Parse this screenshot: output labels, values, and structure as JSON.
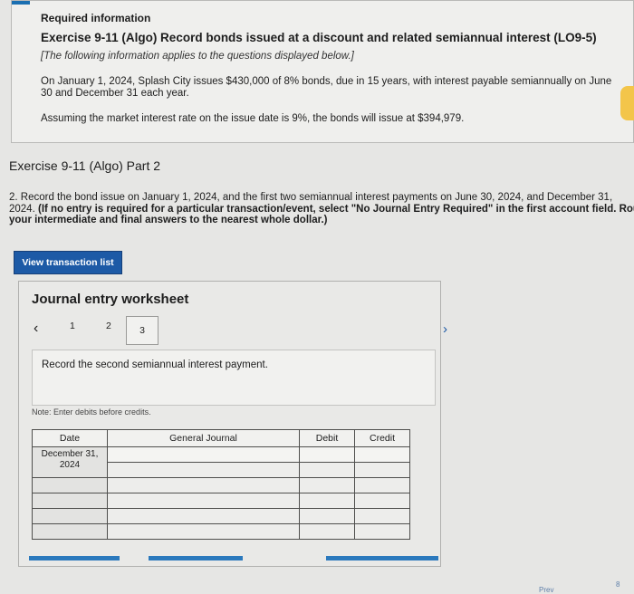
{
  "info": {
    "required": "Required information",
    "exercise_title": "Exercise 9-11 (Algo) Record bonds issued at a discount and related semiannual interest (LO9-5)",
    "note": "[The following information applies to the questions displayed below.]",
    "paragraph1": "On January 1, 2024, Splash City issues $430,000 of 8% bonds, due in 15 years, with interest payable semiannually on June 30 and December 31 each year.",
    "paragraph2": "Assuming the market interest rate on the issue date is 9%, the bonds will issue at $394,979."
  },
  "part_title": "Exercise 9-11 (Algo) Part 2",
  "question": {
    "line1": "2. Record the bond issue on January 1, 2024, and the first two semiannual interest payments on June 30, 2024, and December 31,",
    "line2_plain": "2024. ",
    "line2_bold": "(If no entry is required for a particular transaction/event, select \"No Journal Entry Required\" in the first account field. Rou",
    "line3_bold": "your intermediate and final answers to the nearest whole dollar.)"
  },
  "view_transaction_button": "View transaction list",
  "worksheet": {
    "title": "Journal entry worksheet",
    "pages": [
      "1",
      "2",
      "3"
    ],
    "active_page": "3",
    "instruction": "Record the second semiannual interest payment.",
    "note": "Note: Enter debits before credits.",
    "columns": {
      "date": "Date",
      "general_journal": "General Journal",
      "debit": "Debit",
      "credit": "Credit"
    },
    "date_value": "December 31,\n2024"
  },
  "footer": {
    "prev_label": "Prev",
    "page_label": "8"
  },
  "colors": {
    "accent": "#1d5aa6",
    "background": "#e6e6e4"
  }
}
